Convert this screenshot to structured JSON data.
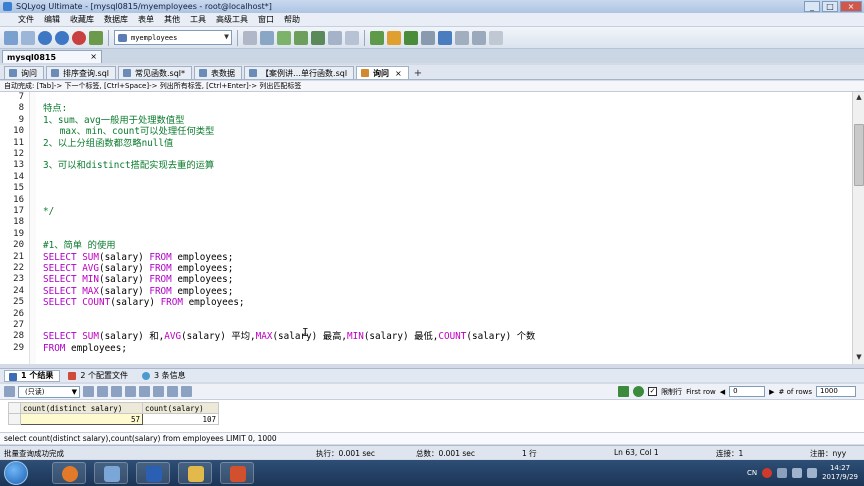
{
  "window": {
    "title": "SQLyog Ultimate - [mysql0815/myemployees - root@localhost*]",
    "min": "_",
    "max": "□",
    "close": "×"
  },
  "menu": [
    "文件",
    "编辑",
    "收藏库",
    "数据库",
    "表单",
    "其他",
    "工具",
    "高级工具",
    "窗口",
    "帮助"
  ],
  "toolbar": {
    "database": "myemployees"
  },
  "connection_tab": {
    "label": "mysql0815",
    "close": "×"
  },
  "query_tabs": [
    {
      "label": "询问"
    },
    {
      "label": "排序查询.sql"
    },
    {
      "label": "常见函数.sql*"
    },
    {
      "label": "表数据"
    },
    {
      "label": "【案例讲…单行函数.sql"
    },
    {
      "label": "询问",
      "active": true,
      "close": "×"
    }
  ],
  "add_tab": "+",
  "hint": "自动完成: [Tab]-> 下一个标签, [Ctrl+Space]-> 列出所有标签, [Ctrl+Enter]-> 列出匹配标签",
  "editor": {
    "line_numbers": [
      "7",
      "8",
      "9",
      "10",
      "11",
      "12",
      "13",
      "14",
      "15",
      "16",
      "17",
      "18",
      "19",
      "20",
      "21",
      "22",
      "23",
      "24",
      "25",
      "26",
      "27",
      "28",
      "29"
    ],
    "cursor_glyph": "I"
  },
  "result_tabs": [
    {
      "label": "1 个结果",
      "active": true
    },
    {
      "label": "2 个配置文件"
    },
    {
      "label": "3 条信息"
    }
  ],
  "result_tools": {
    "mode": "(只读)",
    "limit_label": "限制行",
    "first_row_label": "First row",
    "first_row_value": "0",
    "rows_label": "# of rows",
    "rows_value": "1000",
    "checked": "✓"
  },
  "grid": {
    "columns": [
      "count(distinct salary)",
      "count(salary)"
    ],
    "rows": [
      [
        "57",
        "107"
      ]
    ]
  },
  "sql_line": "select count(distinct salary),count(salary) from employees LIMIT 0, 1000",
  "status": {
    "left": "批量查询成功完成",
    "exec": "执行：0.001 sec",
    "total": "总数：0.001 sec",
    "rows": "1 行",
    "pos": "Ln 63, Col 1",
    "conn": "连接：1",
    "reg": "注册：nyy"
  },
  "tray": {
    "lang": "CN",
    "time": "14:27",
    "date": "2017/9/29"
  }
}
